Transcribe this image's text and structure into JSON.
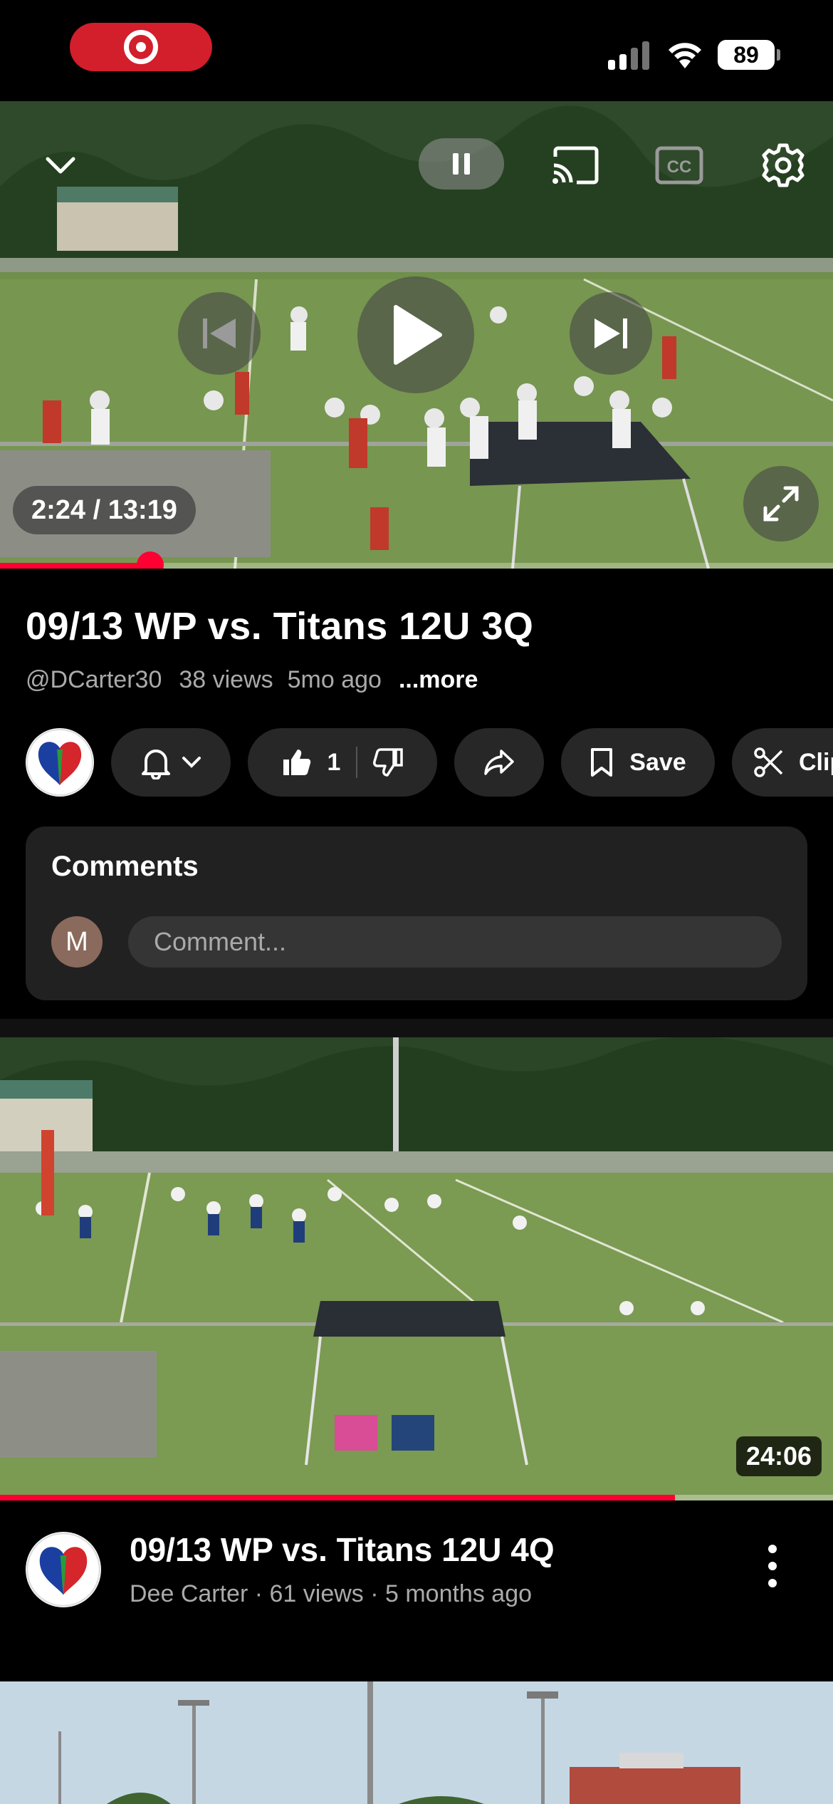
{
  "status_bar": {
    "battery": "89",
    "icons": [
      "screen-record-icon",
      "cellular-signal-icon",
      "wifi-icon",
      "battery-icon"
    ]
  },
  "player": {
    "time_display": "2:24 / 13:19",
    "progress": 0.18,
    "icons": [
      "chevron-down-icon",
      "pause-icon",
      "cast-icon",
      "closed-captions-icon",
      "settings-gear-icon",
      "previous-icon",
      "play-icon",
      "next-icon",
      "fullscreen-icon"
    ]
  },
  "video": {
    "title": "09/13 WP vs. Titans 12U 3Q",
    "channel_handle": "@DCarter30",
    "views": "38 views",
    "age": "5mo ago",
    "more_label": "...more"
  },
  "actions": {
    "like_count": "1",
    "save_label": "Save",
    "clip_label": "Clip",
    "icons": [
      "bell-icon",
      "chevron-down-icon",
      "thumbs-up-icon",
      "thumbs-down-icon",
      "share-icon",
      "bookmark-icon",
      "scissors-icon"
    ]
  },
  "comments": {
    "heading": "Comments",
    "user_initial": "M",
    "placeholder": "Comment..."
  },
  "next_video": {
    "duration": "24:06",
    "watched": 0.81,
    "title": "09/13 WP vs. Titans 12U 4Q",
    "subtitle": "Dee Carter · 61 views · 5 months ago"
  },
  "colors": {
    "accent_red": "#ff0033",
    "chip_background": "#272727",
    "comments_background": "#212121",
    "secondary_text": "#aaaaaa"
  }
}
